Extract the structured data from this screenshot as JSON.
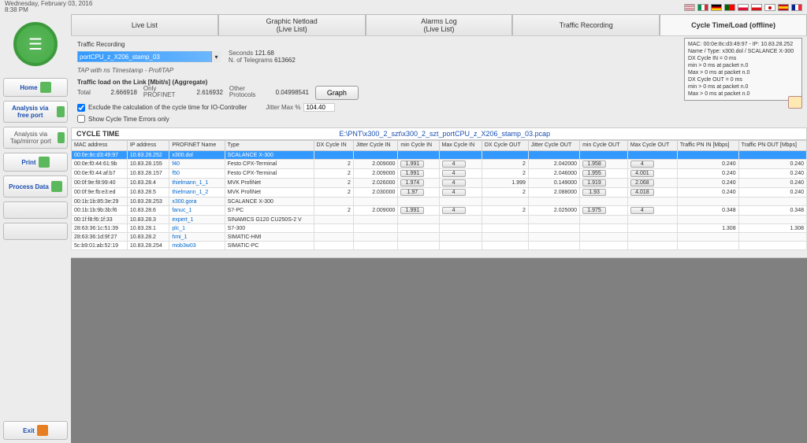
{
  "header": {
    "date_line1": "Wednesday, February 03, 2016",
    "date_line2": "8:38 PM"
  },
  "sidebar": {
    "home": "Home",
    "analysis_free": "Analysis via free port",
    "analysis_tap": "Analysis via Tap/mirror port",
    "print": "Print",
    "process_data": "Process Data",
    "exit": "Exit"
  },
  "tabs": {
    "live_list": "Live List",
    "graphic_netload": "Graphic Netload",
    "graphic_netload_sub": "(Live List)",
    "alarms_log": "Alarms Log",
    "alarms_log_sub": "(Live List)",
    "traffic_recording": "Traffic Recording",
    "cycle_time": "Cycle Time/Load (offline)"
  },
  "controls": {
    "section_title": "Traffic Recording",
    "dropdown_value": "portCPU_z_X206_stamp_03",
    "tap_note": "TAP with ns Timestamp - ProfiTAP",
    "seconds_label": "Seconds",
    "seconds_value": "121.68",
    "telegrams_label": "N. of Telegrams",
    "telegrams_value": "613662",
    "traffic_load_label": "Traffic load on the Link [Mbit/s] (Aggregate)",
    "total_label": "Total",
    "total_value": "2.666918",
    "only_profinet_label": "Only PROFINET",
    "only_profinet_value": "2.616932",
    "other_protocols_label": "Other Protocols",
    "other_protocols_value": "0.04998541",
    "graph_btn": "Graph",
    "exclude_label": "Exclude the calculation of the cycle time for IO-Controller",
    "errors_only_label": "Show Cycle Time Errors only",
    "jitter_label": "Jitter Max %",
    "jitter_value": "104.40"
  },
  "info_box": {
    "l1": "MAC: 00:0e:8c:d3:49:97 - IP: 10.83.28.252",
    "l2": "Name / Type:  x300.dol / SCALANCE X-300",
    "l3": "DX Cycle IN = 0 ms",
    "l4": "    min > 0 ms at packet n.0",
    "l5": "    Max > 0 ms at packet n.0",
    "l6": "DX Cycle OUT = 0 ms",
    "l7": "    min > 0 ms at packet n.0",
    "l8": "    Max > 0 ms at packet n.0"
  },
  "cycle_row": {
    "title": "CYCLE TIME",
    "path": "E:\\PNT\\x300_2_szt\\x300_2_szt_portCPU_z_X206_stamp_03.pcap"
  },
  "columns": [
    "MAC address",
    "IP address",
    "PROFINET Name",
    "Type",
    "DX Cycle IN",
    "Jitter Cycle IN",
    "min Cycle IN",
    "Max Cycle IN",
    "DX Cycle OUT",
    "Jitter Cycle OUT",
    "min Cycle OUT",
    "Max Cycle OUT",
    "Traffic PN IN [Mbps]",
    "Traffic PN OUT [Mbps]"
  ],
  "rows": [
    {
      "mac": "00:0e:8c:d3:49:97",
      "ip": "10.83.28.252",
      "name": "x300.dol",
      "type": "SCALANCE X-300",
      "dxin": "",
      "jin": "",
      "minin": "",
      "maxin": "",
      "dxout": "",
      "jout": "",
      "minout": "",
      "maxout": "",
      "tin": "",
      "tout": "",
      "hl": true
    },
    {
      "mac": "00:0e:f0:44:61:9b",
      "ip": "10.83.28.155",
      "name": "f40",
      "type": "Festo CPX-Terminal",
      "dxin": "2",
      "jin": "2.009000",
      "minin": "1.991",
      "maxin": "4",
      "dxout": "2",
      "jout": "2.042000",
      "minout": "1.958",
      "maxout": "4",
      "tin": "0.240",
      "tout": "0.240"
    },
    {
      "mac": "00:0e:f0:44:af:b7",
      "ip": "10.83.28.157",
      "name": "f50",
      "type": "Festo CPX-Terminal",
      "dxin": "2",
      "jin": "2.009000",
      "minin": "1.991",
      "maxin": "4",
      "dxout": "2",
      "jout": "2.046000",
      "minout": "1.955",
      "maxout": "4.001",
      "tin": "0.240",
      "tout": "0.240"
    },
    {
      "mac": "00:0f:9e:f8:99:40",
      "ip": "10.83.28.4",
      "name": "thielmann_1_1",
      "type": "MVK ProfiNet",
      "dxin": "2",
      "jin": "2.026000",
      "minin": "1.974",
      "maxin": "4",
      "dxout": "1.999",
      "jout": "0.149000",
      "minout": "1.919",
      "maxout": "2.068",
      "tin": "0.240",
      "tout": "0.240"
    },
    {
      "mac": "00:0f:9e:fb:e3:ed",
      "ip": "10.83.28.5",
      "name": "thielmann_1_2",
      "type": "MVK ProfiNet",
      "dxin": "2",
      "jin": "2.030000",
      "minin": "1.97",
      "maxin": "4",
      "dxout": "2",
      "jout": "2.088000",
      "minout": "1.93",
      "maxout": "4.018",
      "tin": "0.240",
      "tout": "0.240"
    },
    {
      "mac": "00:1b:1b:85:3e:29",
      "ip": "10.83.28.253",
      "name": "x300.gora",
      "type": "SCALANCE X-300",
      "dxin": "",
      "jin": "",
      "minin": "",
      "maxin": "",
      "dxout": "",
      "jout": "",
      "minout": "",
      "maxout": "",
      "tin": "",
      "tout": ""
    },
    {
      "mac": "00:1b:1b:9b:3b:f6",
      "ip": "10.83.28.6",
      "name": "fanuc_1",
      "type": "S7-PC",
      "dxin": "2",
      "jin": "2.009000",
      "minin": "1.991",
      "maxin": "4",
      "dxout": "2",
      "jout": "2.025000",
      "minout": "1.975",
      "maxout": "4",
      "tin": "0.348",
      "tout": "0.348"
    },
    {
      "mac": "00:1f:f8:f6:1f:33",
      "ip": "10.83.28.3",
      "name": "expert_1",
      "type": "SINAMICS G120 CU250S-2 V",
      "dxin": "",
      "jin": "",
      "minin": "",
      "maxin": "",
      "dxout": "",
      "jout": "",
      "minout": "",
      "maxout": "",
      "tin": "",
      "tout": ""
    },
    {
      "mac": "28:63:36:1c:51:39",
      "ip": "10.83.28.1",
      "name": "plc_1",
      "type": "S7-300",
      "dxin": "",
      "jin": "",
      "minin": "",
      "maxin": "",
      "dxout": "",
      "jout": "",
      "minout": "",
      "maxout": "",
      "tin": "1.308",
      "tout": "1.308"
    },
    {
      "mac": "28:63:36:1d:9f:27",
      "ip": "10.83.28.2",
      "name": "hmi_1",
      "type": "SIMATIC-HMI",
      "dxin": "",
      "jin": "",
      "minin": "",
      "maxin": "",
      "dxout": "",
      "jout": "",
      "minout": "",
      "maxout": "",
      "tin": "",
      "tout": ""
    },
    {
      "mac": "5c:b9:01:ab:52:19",
      "ip": "10.83.28.254",
      "name": "mob3w03",
      "type": "SIMATIC-PC",
      "dxin": "",
      "jin": "",
      "minin": "",
      "maxin": "",
      "dxout": "",
      "jout": "",
      "minout": "",
      "maxout": "",
      "tin": "",
      "tout": ""
    }
  ]
}
